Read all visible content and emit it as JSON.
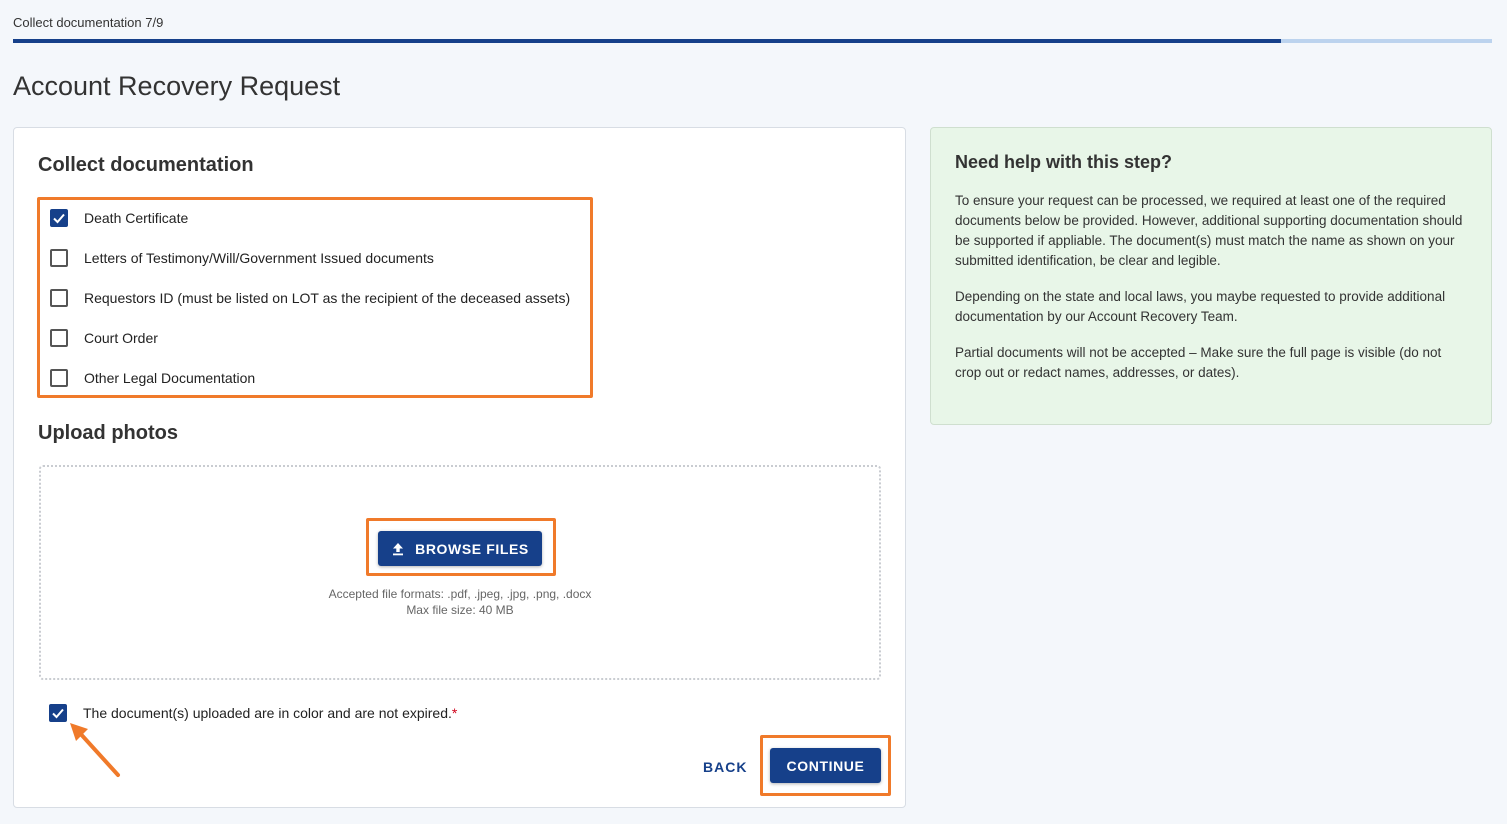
{
  "header": {
    "step_label": "Collect documentation 7/9",
    "progress_fraction": 0.857,
    "page_title": "Account Recovery Request"
  },
  "main": {
    "collect_title": "Collect documentation",
    "documents": [
      {
        "label": "Death Certificate",
        "checked": true
      },
      {
        "label": "Letters of Testimony/Will/Government Issued documents",
        "checked": false
      },
      {
        "label": "Requestors ID (must be listed on LOT as the recipient of the deceased assets)",
        "checked": false
      },
      {
        "label": "Court Order",
        "checked": false
      },
      {
        "label": "Other Legal Documentation",
        "checked": false
      }
    ],
    "upload_title": "Upload photos",
    "browse_label": "BROWSE FILES",
    "accepted_formats": "Accepted file formats: .pdf, .jpeg, .jpg, .png, .docx",
    "max_size": "Max file size: 40 MB",
    "confirm_label": "The document(s) uploaded are in color and are not expired.",
    "confirm_required": "*",
    "confirm_checked": true,
    "back_label": "BACK",
    "continue_label": "CONTINUE"
  },
  "help": {
    "title": "Need help with this step?",
    "paragraphs": [
      "To ensure your request can be processed, we required at least one of the required documents below be provided. However, additional supporting documentation should be supported if appliable. The document(s) must match the name as shown on your submitted identification, be clear and legible.",
      "Depending on the state and local laws, you maybe requested to provide additional documentation by our Account Recovery Team.",
      "Partial documents will not be accepted – Make sure the full page is visible (do not crop out or redact names, addresses, or dates)."
    ]
  },
  "colors": {
    "primary": "#16408a",
    "highlight": "#f07a2a",
    "help_bg": "#e8f6e8"
  },
  "icons": {
    "checkmark": "checkmark-icon",
    "upload": "upload-icon",
    "arrow": "arrow-annotation-icon"
  }
}
